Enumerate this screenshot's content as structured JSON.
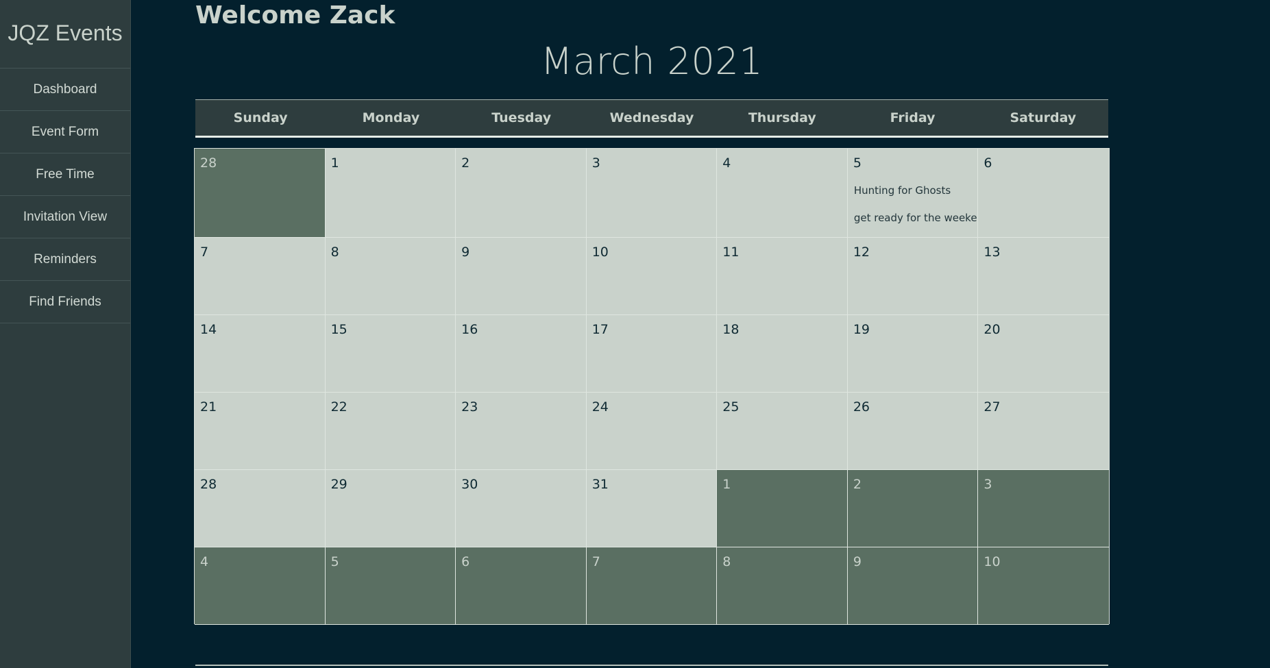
{
  "sidebar": {
    "brand": "JQZ Events",
    "items": [
      {
        "label": "Dashboard"
      },
      {
        "label": "Event Form"
      },
      {
        "label": "Free Time"
      },
      {
        "label": "Invitation View"
      },
      {
        "label": "Reminders"
      },
      {
        "label": "Find Friends"
      }
    ]
  },
  "header": {
    "welcome": "Welcome Zack",
    "month_title": "March 2021"
  },
  "calendar": {
    "weekdays": [
      "Sunday",
      "Monday",
      "Tuesday",
      "Wednesday",
      "Thursday",
      "Friday",
      "Saturday"
    ],
    "days": [
      {
        "day": "28",
        "other": true
      },
      {
        "day": "1"
      },
      {
        "day": "2"
      },
      {
        "day": "3"
      },
      {
        "day": "4"
      },
      {
        "day": "5",
        "events": [
          "Hunting for Ghosts",
          "get ready for the weekend"
        ]
      },
      {
        "day": "6"
      },
      {
        "day": "7"
      },
      {
        "day": "8"
      },
      {
        "day": "9"
      },
      {
        "day": "10"
      },
      {
        "day": "11"
      },
      {
        "day": "12"
      },
      {
        "day": "13"
      },
      {
        "day": "14"
      },
      {
        "day": "15"
      },
      {
        "day": "16"
      },
      {
        "day": "17"
      },
      {
        "day": "18"
      },
      {
        "day": "19"
      },
      {
        "day": "20"
      },
      {
        "day": "21"
      },
      {
        "day": "22"
      },
      {
        "day": "23"
      },
      {
        "day": "24"
      },
      {
        "day": "25"
      },
      {
        "day": "26"
      },
      {
        "day": "27"
      },
      {
        "day": "28"
      },
      {
        "day": "29"
      },
      {
        "day": "30"
      },
      {
        "day": "31"
      },
      {
        "day": "1",
        "other": true
      },
      {
        "day": "2",
        "other": true
      },
      {
        "day": "3",
        "other": true
      },
      {
        "day": "4",
        "other": true
      },
      {
        "day": "5",
        "other": true
      },
      {
        "day": "6",
        "other": true
      },
      {
        "day": "7",
        "other": true
      },
      {
        "day": "8",
        "other": true
      },
      {
        "day": "9",
        "other": true
      },
      {
        "day": "10",
        "other": true
      }
    ]
  },
  "colors": {
    "page_bg": "#03202d",
    "sidebar_bg": "#2e3d3e",
    "cell_bg": "#c9d2cb",
    "other_month_bg": "#5a6f62"
  }
}
